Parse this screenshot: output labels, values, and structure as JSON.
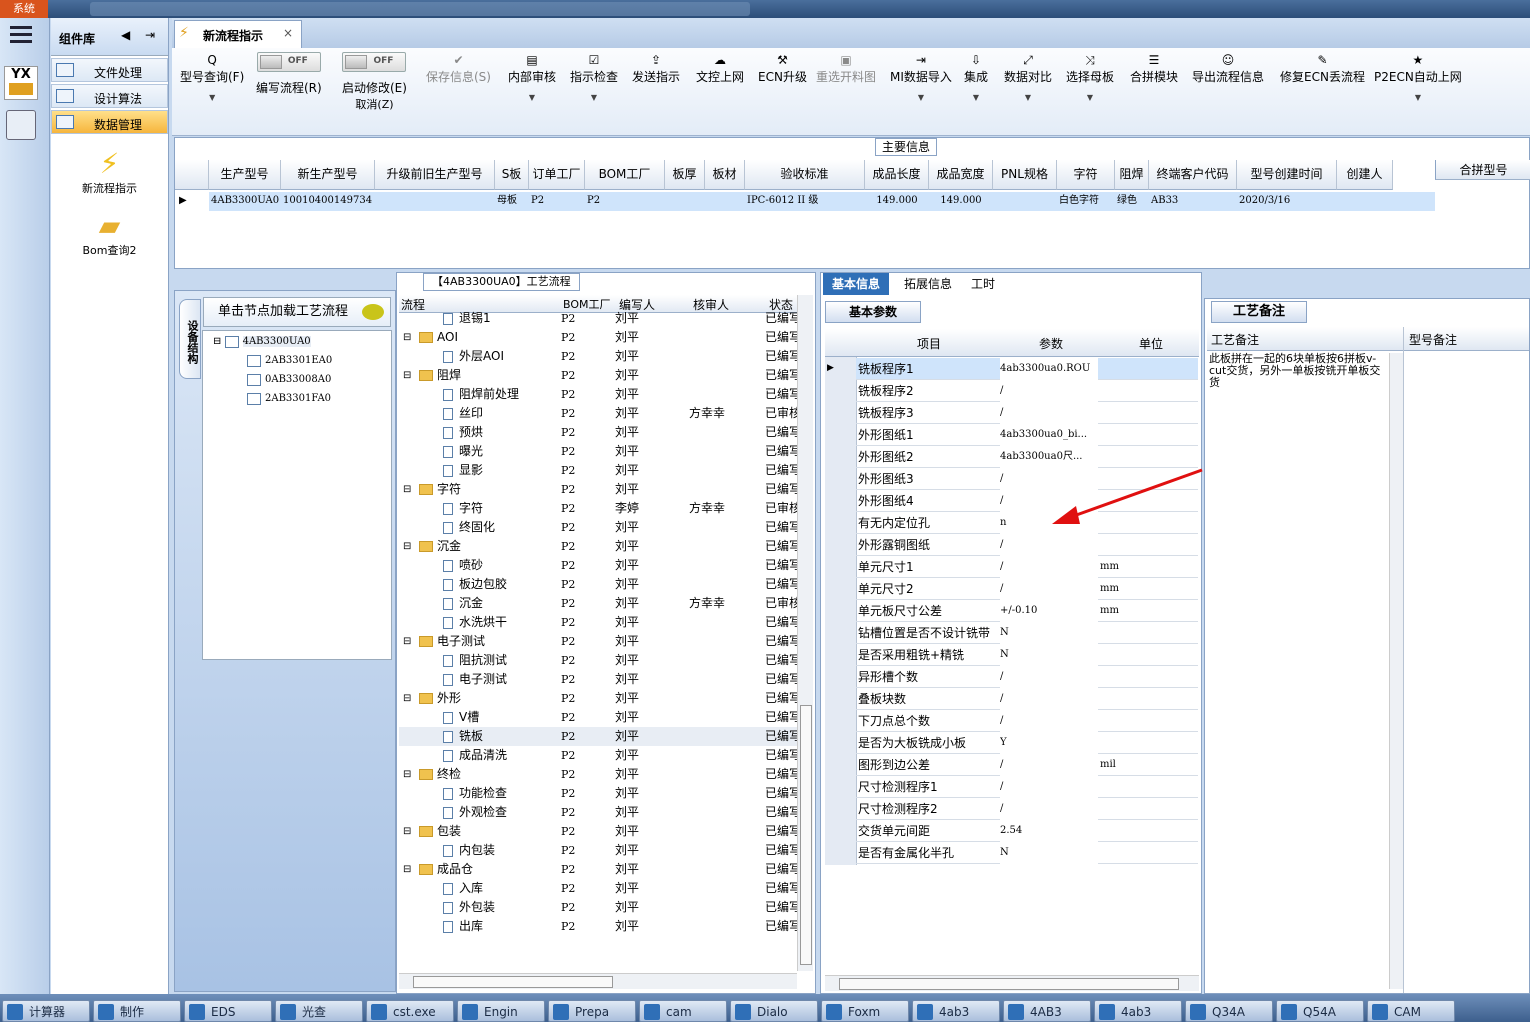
{
  "topbar": {
    "system_label": "系统"
  },
  "leftstrip": {
    "yx": "YX"
  },
  "component_lib": {
    "title": "组件库",
    "items": [
      {
        "label": "文件处理"
      },
      {
        "label": "设计算法"
      },
      {
        "label": "数据管理"
      }
    ],
    "big_items": [
      {
        "label": "新流程指示"
      },
      {
        "label": "Bom查询2"
      }
    ]
  },
  "doc_tab": {
    "title": "新流程指示",
    "close": "×"
  },
  "toolbar": {
    "items": [
      {
        "label": "型号查询(F)",
        "icon": "Q"
      },
      {
        "label": "编写流程(R)",
        "toggle": "OFF"
      },
      {
        "label": "启动修改(E)",
        "sub": "取消(Z)",
        "toggle": "OFF"
      },
      {
        "label": "保存信息(S)",
        "icon": "✔"
      },
      {
        "label": "内部审核",
        "icon": "▤"
      },
      {
        "label": "指示检查",
        "icon": "☑"
      },
      {
        "label": "发送指示",
        "icon": "⇪"
      },
      {
        "label": "文控上网",
        "icon": "☁"
      },
      {
        "label": "ECN升级",
        "icon": "⚒"
      },
      {
        "label": "重选开料图",
        "icon": "▣"
      },
      {
        "label": "MI数据导入",
        "icon": "⇥"
      },
      {
        "label": "集成",
        "icon": "⇩"
      },
      {
        "label": "数据对比",
        "icon": "⤢"
      },
      {
        "label": "选择母板",
        "icon": "⤨"
      },
      {
        "label": "合拼模块",
        "icon": "☰"
      },
      {
        "label": "导出流程信息",
        "icon": "☺"
      },
      {
        "label": "修复ECN丢流程",
        "icon": "✎"
      },
      {
        "label": "P2ECN自动上网",
        "icon": "★"
      }
    ]
  },
  "main_info": {
    "title": "主要信息",
    "columns": [
      "生产型号",
      "新生产型号",
      "升级前旧生产型号",
      "S板",
      "订单工厂",
      "BOM工厂",
      "板厚",
      "板材",
      "验收标准",
      "成品长度",
      "成品宽度",
      "PNL规格",
      "字符",
      "阻焊",
      "终端客户代码",
      "型号创建时间",
      "创建人"
    ],
    "row": [
      "4AB3300UA0",
      "10010400149734",
      "",
      "母板",
      "P2",
      "P2",
      "",
      "",
      "IPC-6012 II 级",
      "149.000",
      "149.000",
      "",
      "白色字符",
      "绿色",
      "AB33",
      "2020/3/16",
      ""
    ],
    "side_col": "合拼型号"
  },
  "left_dock": {
    "vertical_tab": "设备结构",
    "load_label": "单击节点加载工艺流程",
    "tree": [
      "4AB3300UA0",
      "2AB3301EA0",
      "0AB33008A0",
      "2AB3301FA0"
    ]
  },
  "process": {
    "title": "【4AB3300UA0】工艺流程",
    "columns": [
      "流程",
      "BOM工厂",
      "编写人",
      "核审人",
      "状态"
    ],
    "rows": [
      {
        "name": "退锡1",
        "level": 2,
        "bom": "P2",
        "writer": "刘平",
        "reviewer": "",
        "status": "已编写"
      },
      {
        "name": "AOI",
        "level": 1,
        "bom": "P2",
        "writer": "刘平",
        "reviewer": "",
        "status": "已编写"
      },
      {
        "name": "外层AOI",
        "level": 2,
        "bom": "P2",
        "writer": "刘平",
        "reviewer": "",
        "status": "已编写"
      },
      {
        "name": "阻焊",
        "level": 1,
        "bom": "P2",
        "writer": "刘平",
        "reviewer": "",
        "status": "已编写"
      },
      {
        "name": "阻焊前处理",
        "level": 2,
        "bom": "P2",
        "writer": "刘平",
        "reviewer": "",
        "status": "已编写"
      },
      {
        "name": "丝印",
        "level": 2,
        "bom": "P2",
        "writer": "刘平",
        "reviewer": "方幸幸",
        "status": "已审核"
      },
      {
        "name": "预烘",
        "level": 2,
        "bom": "P2",
        "writer": "刘平",
        "reviewer": "",
        "status": "已编写"
      },
      {
        "name": "曝光",
        "level": 2,
        "bom": "P2",
        "writer": "刘平",
        "reviewer": "",
        "status": "已编写"
      },
      {
        "name": "显影",
        "level": 2,
        "bom": "P2",
        "writer": "刘平",
        "reviewer": "",
        "status": "已编写"
      },
      {
        "name": "字符",
        "level": 1,
        "bom": "P2",
        "writer": "刘平",
        "reviewer": "",
        "status": "已编写"
      },
      {
        "name": "字符",
        "level": 2,
        "bom": "P2",
        "writer": "李婷",
        "reviewer": "方幸幸",
        "status": "已审核"
      },
      {
        "name": "终固化",
        "level": 2,
        "bom": "P2",
        "writer": "刘平",
        "reviewer": "",
        "status": "已编写"
      },
      {
        "name": "沉金",
        "level": 1,
        "bom": "P2",
        "writer": "刘平",
        "reviewer": "",
        "status": "已编写"
      },
      {
        "name": "喷砂",
        "level": 2,
        "bom": "P2",
        "writer": "刘平",
        "reviewer": "",
        "status": "已编写"
      },
      {
        "name": "板边包胶",
        "level": 2,
        "bom": "P2",
        "writer": "刘平",
        "reviewer": "",
        "status": "已编写"
      },
      {
        "name": "沉金",
        "level": 2,
        "bom": "P2",
        "writer": "刘平",
        "reviewer": "方幸幸",
        "status": "已审核"
      },
      {
        "name": "水洗烘干",
        "level": 2,
        "bom": "P2",
        "writer": "刘平",
        "reviewer": "",
        "status": "已编写"
      },
      {
        "name": "电子测试",
        "level": 1,
        "bom": "P2",
        "writer": "刘平",
        "reviewer": "",
        "status": "已编写"
      },
      {
        "name": "阻抗测试",
        "level": 2,
        "bom": "P2",
        "writer": "刘平",
        "reviewer": "",
        "status": "已编写"
      },
      {
        "name": "电子测试",
        "level": 2,
        "bom": "P2",
        "writer": "刘平",
        "reviewer": "",
        "status": "已编写"
      },
      {
        "name": "外形",
        "level": 1,
        "bom": "P2",
        "writer": "刘平",
        "reviewer": "",
        "status": "已编写"
      },
      {
        "name": "V槽",
        "level": 2,
        "bom": "P2",
        "writer": "刘平",
        "reviewer": "",
        "status": "已编写"
      },
      {
        "name": "铣板",
        "level": 2,
        "bom": "P2",
        "writer": "刘平",
        "reviewer": "",
        "status": "已编写",
        "selected": true
      },
      {
        "name": "成品清洗",
        "level": 2,
        "bom": "P2",
        "writer": "刘平",
        "reviewer": "",
        "status": "已编写"
      },
      {
        "name": "终检",
        "level": 1,
        "bom": "P2",
        "writer": "刘平",
        "reviewer": "",
        "status": "已编写"
      },
      {
        "name": "功能检查",
        "level": 2,
        "bom": "P2",
        "writer": "刘平",
        "reviewer": "",
        "status": "已编写"
      },
      {
        "name": "外观检查",
        "level": 2,
        "bom": "P2",
        "writer": "刘平",
        "reviewer": "",
        "status": "已编写"
      },
      {
        "name": "包装",
        "level": 1,
        "bom": "P2",
        "writer": "刘平",
        "reviewer": "",
        "status": "已编写"
      },
      {
        "name": "内包装",
        "level": 2,
        "bom": "P2",
        "writer": "刘平",
        "reviewer": "",
        "status": "已编写"
      },
      {
        "name": "成品仓",
        "level": 1,
        "bom": "P2",
        "writer": "刘平",
        "reviewer": "",
        "status": "已编写"
      },
      {
        "name": "入库",
        "level": 2,
        "bom": "P2",
        "writer": "刘平",
        "reviewer": "",
        "status": "已编写"
      },
      {
        "name": "外包装",
        "level": 2,
        "bom": "P2",
        "writer": "刘平",
        "reviewer": "",
        "status": "已编写"
      },
      {
        "name": "出库",
        "level": 2,
        "bom": "P2",
        "writer": "刘平",
        "reviewer": "",
        "status": "已编写"
      }
    ]
  },
  "detail": {
    "tabs": [
      "基本信息",
      "拓展信息",
      "工时"
    ],
    "subtab": "基本参数",
    "columns": [
      "项目",
      "参数",
      "单位"
    ],
    "rows": [
      {
        "k": "铣板程序1",
        "v": "4ab3300ua0.ROU",
        "u": ""
      },
      {
        "k": "铣板程序2",
        "v": "/",
        "u": ""
      },
      {
        "k": "铣板程序3",
        "v": "/",
        "u": ""
      },
      {
        "k": "外形图纸1",
        "v": "4ab3300ua0_bi...",
        "u": ""
      },
      {
        "k": "外形图纸2",
        "v": "4ab3300ua0尺...",
        "u": ""
      },
      {
        "k": "外形图纸3",
        "v": "/",
        "u": ""
      },
      {
        "k": "外形图纸4",
        "v": "/",
        "u": ""
      },
      {
        "k": "有无内定位孔",
        "v": "n",
        "u": ""
      },
      {
        "k": "外形露铜图纸",
        "v": "/",
        "u": ""
      },
      {
        "k": "单元尺寸1",
        "v": "/",
        "u": "mm"
      },
      {
        "k": "单元尺寸2",
        "v": "/",
        "u": "mm"
      },
      {
        "k": "单元板尺寸公差",
        "v": "+/-0.10",
        "u": "mm"
      },
      {
        "k": "钻槽位置是否不设计铣带",
        "v": "N",
        "u": ""
      },
      {
        "k": "是否采用粗铣+精铣",
        "v": "N",
        "u": ""
      },
      {
        "k": "异形槽个数",
        "v": "/",
        "u": ""
      },
      {
        "k": "叠板块数",
        "v": "/",
        "u": ""
      },
      {
        "k": "下刀点总个数",
        "v": "/",
        "u": ""
      },
      {
        "k": "是否为大板铣成小板",
        "v": "Y",
        "u": ""
      },
      {
        "k": "图形到边公差",
        "v": "/",
        "u": "mil"
      },
      {
        "k": "尺寸检测程序1",
        "v": "/",
        "u": ""
      },
      {
        "k": "尺寸检测程序2",
        "v": "/",
        "u": ""
      },
      {
        "k": "交货单元间距",
        "v": "2.54",
        "u": ""
      },
      {
        "k": "是否有金属化半孔",
        "v": "N",
        "u": ""
      }
    ]
  },
  "notes": {
    "tab": "工艺备注",
    "col1": "工艺备注",
    "col2": "型号备注",
    "text": "此板拼在一起的6块单板按6拼板v-cut交货，另外一单板按铣开单板交货"
  },
  "taskbar": [
    {
      "label": "计算器"
    },
    {
      "label": "制作"
    },
    {
      "label": "EDS"
    },
    {
      "label": "光查"
    },
    {
      "label": "cst.exe"
    },
    {
      "label": "Engin"
    },
    {
      "label": "Prepa"
    },
    {
      "label": "cam"
    },
    {
      "label": "Dialo"
    },
    {
      "label": "Foxm"
    },
    {
      "label": "4ab3"
    },
    {
      "label": "4AB3"
    },
    {
      "label": "4ab3"
    },
    {
      "label": "Q34A"
    },
    {
      "label": "Q54A"
    },
    {
      "label": "CAM"
    }
  ]
}
